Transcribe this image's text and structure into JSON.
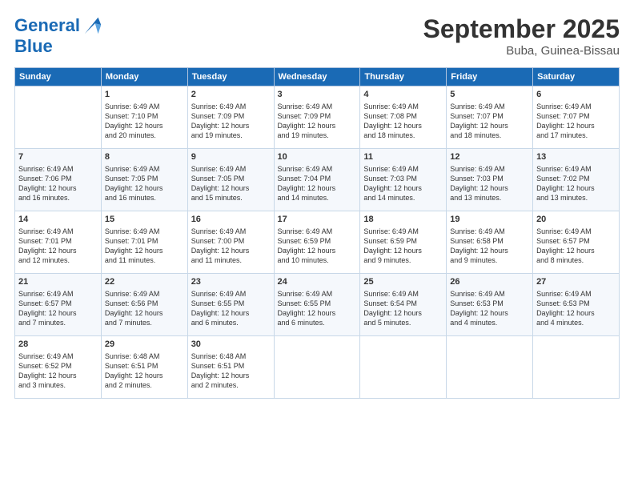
{
  "header": {
    "logo_line1": "General",
    "logo_line2": "Blue",
    "title": "September 2025",
    "subtitle": "Buba, Guinea-Bissau"
  },
  "weekdays": [
    "Sunday",
    "Monday",
    "Tuesday",
    "Wednesday",
    "Thursday",
    "Friday",
    "Saturday"
  ],
  "weeks": [
    [
      {
        "day": "",
        "text": ""
      },
      {
        "day": "1",
        "text": "Sunrise: 6:49 AM\nSunset: 7:10 PM\nDaylight: 12 hours\nand 20 minutes."
      },
      {
        "day": "2",
        "text": "Sunrise: 6:49 AM\nSunset: 7:09 PM\nDaylight: 12 hours\nand 19 minutes."
      },
      {
        "day": "3",
        "text": "Sunrise: 6:49 AM\nSunset: 7:09 PM\nDaylight: 12 hours\nand 19 minutes."
      },
      {
        "day": "4",
        "text": "Sunrise: 6:49 AM\nSunset: 7:08 PM\nDaylight: 12 hours\nand 18 minutes."
      },
      {
        "day": "5",
        "text": "Sunrise: 6:49 AM\nSunset: 7:07 PM\nDaylight: 12 hours\nand 18 minutes."
      },
      {
        "day": "6",
        "text": "Sunrise: 6:49 AM\nSunset: 7:07 PM\nDaylight: 12 hours\nand 17 minutes."
      }
    ],
    [
      {
        "day": "7",
        "text": "Sunrise: 6:49 AM\nSunset: 7:06 PM\nDaylight: 12 hours\nand 16 minutes."
      },
      {
        "day": "8",
        "text": "Sunrise: 6:49 AM\nSunset: 7:05 PM\nDaylight: 12 hours\nand 16 minutes."
      },
      {
        "day": "9",
        "text": "Sunrise: 6:49 AM\nSunset: 7:05 PM\nDaylight: 12 hours\nand 15 minutes."
      },
      {
        "day": "10",
        "text": "Sunrise: 6:49 AM\nSunset: 7:04 PM\nDaylight: 12 hours\nand 14 minutes."
      },
      {
        "day": "11",
        "text": "Sunrise: 6:49 AM\nSunset: 7:03 PM\nDaylight: 12 hours\nand 14 minutes."
      },
      {
        "day": "12",
        "text": "Sunrise: 6:49 AM\nSunset: 7:03 PM\nDaylight: 12 hours\nand 13 minutes."
      },
      {
        "day": "13",
        "text": "Sunrise: 6:49 AM\nSunset: 7:02 PM\nDaylight: 12 hours\nand 13 minutes."
      }
    ],
    [
      {
        "day": "14",
        "text": "Sunrise: 6:49 AM\nSunset: 7:01 PM\nDaylight: 12 hours\nand 12 minutes."
      },
      {
        "day": "15",
        "text": "Sunrise: 6:49 AM\nSunset: 7:01 PM\nDaylight: 12 hours\nand 11 minutes."
      },
      {
        "day": "16",
        "text": "Sunrise: 6:49 AM\nSunset: 7:00 PM\nDaylight: 12 hours\nand 11 minutes."
      },
      {
        "day": "17",
        "text": "Sunrise: 6:49 AM\nSunset: 6:59 PM\nDaylight: 12 hours\nand 10 minutes."
      },
      {
        "day": "18",
        "text": "Sunrise: 6:49 AM\nSunset: 6:59 PM\nDaylight: 12 hours\nand 9 minutes."
      },
      {
        "day": "19",
        "text": "Sunrise: 6:49 AM\nSunset: 6:58 PM\nDaylight: 12 hours\nand 9 minutes."
      },
      {
        "day": "20",
        "text": "Sunrise: 6:49 AM\nSunset: 6:57 PM\nDaylight: 12 hours\nand 8 minutes."
      }
    ],
    [
      {
        "day": "21",
        "text": "Sunrise: 6:49 AM\nSunset: 6:57 PM\nDaylight: 12 hours\nand 7 minutes."
      },
      {
        "day": "22",
        "text": "Sunrise: 6:49 AM\nSunset: 6:56 PM\nDaylight: 12 hours\nand 7 minutes."
      },
      {
        "day": "23",
        "text": "Sunrise: 6:49 AM\nSunset: 6:55 PM\nDaylight: 12 hours\nand 6 minutes."
      },
      {
        "day": "24",
        "text": "Sunrise: 6:49 AM\nSunset: 6:55 PM\nDaylight: 12 hours\nand 6 minutes."
      },
      {
        "day": "25",
        "text": "Sunrise: 6:49 AM\nSunset: 6:54 PM\nDaylight: 12 hours\nand 5 minutes."
      },
      {
        "day": "26",
        "text": "Sunrise: 6:49 AM\nSunset: 6:53 PM\nDaylight: 12 hours\nand 4 minutes."
      },
      {
        "day": "27",
        "text": "Sunrise: 6:49 AM\nSunset: 6:53 PM\nDaylight: 12 hours\nand 4 minutes."
      }
    ],
    [
      {
        "day": "28",
        "text": "Sunrise: 6:49 AM\nSunset: 6:52 PM\nDaylight: 12 hours\nand 3 minutes."
      },
      {
        "day": "29",
        "text": "Sunrise: 6:48 AM\nSunset: 6:51 PM\nDaylight: 12 hours\nand 2 minutes."
      },
      {
        "day": "30",
        "text": "Sunrise: 6:48 AM\nSunset: 6:51 PM\nDaylight: 12 hours\nand 2 minutes."
      },
      {
        "day": "",
        "text": ""
      },
      {
        "day": "",
        "text": ""
      },
      {
        "day": "",
        "text": ""
      },
      {
        "day": "",
        "text": ""
      }
    ]
  ]
}
